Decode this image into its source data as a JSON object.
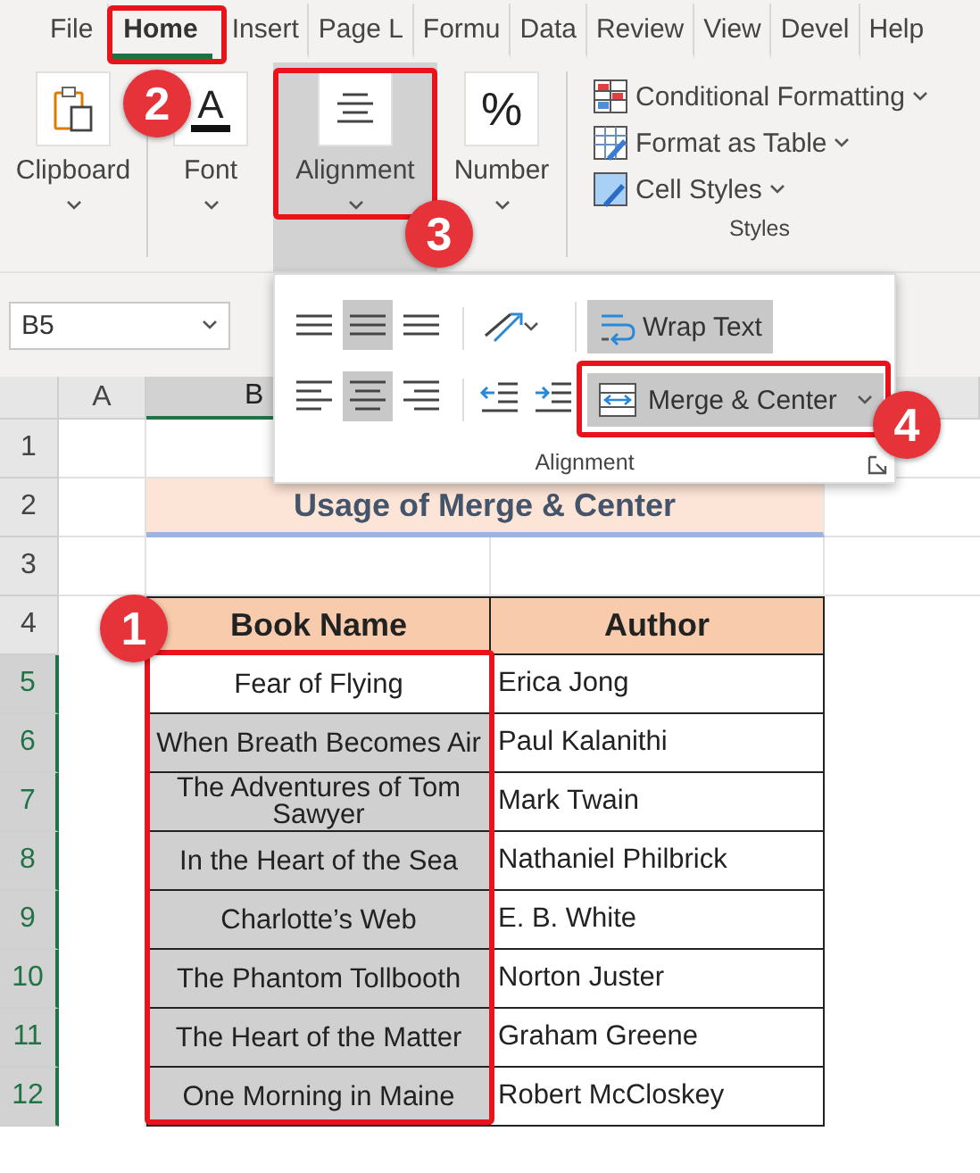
{
  "tabs": [
    {
      "label": "File",
      "selected": false
    },
    {
      "label": "Home",
      "selected": true
    },
    {
      "label": "Insert",
      "selected": false
    },
    {
      "label": "Page L",
      "selected": false
    },
    {
      "label": "Formu",
      "selected": false
    },
    {
      "label": "Data",
      "selected": false
    },
    {
      "label": "Review",
      "selected": false
    },
    {
      "label": "View",
      "selected": false
    },
    {
      "label": "Devel",
      "selected": false
    },
    {
      "label": "Help",
      "selected": false
    }
  ],
  "ribbon_groups": [
    {
      "label": "Clipboard",
      "pressed": false
    },
    {
      "label": "Font",
      "glyph": "A",
      "pressed": false
    },
    {
      "label": "Alignment",
      "pressed": true
    },
    {
      "label": "Number",
      "glyph": "%",
      "pressed": false
    }
  ],
  "styles_group": {
    "items": [
      "Conditional Formatting",
      "Format as Table",
      "Cell Styles"
    ],
    "label": "Styles"
  },
  "name_box": "B5",
  "alignment_panel": {
    "vertical": [
      {
        "selected": false
      },
      {
        "selected": true
      },
      {
        "selected": false
      }
    ],
    "horizontal": [
      {
        "selected": false
      },
      {
        "selected": true
      },
      {
        "selected": false
      }
    ],
    "wrap_text": {
      "label": "Wrap Text",
      "pressed": true
    },
    "merge_center": {
      "label": "Merge & Center",
      "pressed": true
    },
    "label": "Alignment"
  },
  "columns": [
    {
      "label": "A",
      "selected": false
    },
    {
      "label": "B",
      "selected": true
    }
  ],
  "rows": [
    {
      "label": "1",
      "selected": false
    },
    {
      "label": "2",
      "selected": false
    },
    {
      "label": "3",
      "selected": false
    },
    {
      "label": "4",
      "selected": false
    },
    {
      "label": "5",
      "selected": true
    },
    {
      "label": "6",
      "selected": true
    },
    {
      "label": "7",
      "selected": true
    },
    {
      "label": "8",
      "selected": true
    },
    {
      "label": "9",
      "selected": true
    },
    {
      "label": "10",
      "selected": true
    },
    {
      "label": "11",
      "selected": true
    },
    {
      "label": "12",
      "selected": true
    }
  ],
  "title": "Usage of Merge & Center",
  "table": {
    "columns": [
      "Book Name",
      "Author"
    ],
    "rows": [
      {
        "book": "Fear of Flying",
        "author": "Erica Jong",
        "selected": false
      },
      {
        "book": "When Breath Becomes Air",
        "author": "Paul Kalanithi",
        "selected": true
      },
      {
        "book": "The Adventures of Tom Sawyer",
        "author": "Mark Twain",
        "selected": true
      },
      {
        "book": "In the Heart of the Sea",
        "author": "Nathaniel Philbrick",
        "selected": true
      },
      {
        "book": "Charlotte’s Web",
        "author": "E. B. White",
        "selected": true
      },
      {
        "book": "The Phantom Tollbooth",
        "author": "Norton Juster",
        "selected": true
      },
      {
        "book": "The Heart of the Matter",
        "author": "Graham Greene",
        "selected": true
      },
      {
        "book": "One Morning in Maine",
        "author": "Robert McCloskey",
        "selected": true
      }
    ]
  },
  "steps": [
    "1",
    "2",
    "3",
    "4"
  ]
}
